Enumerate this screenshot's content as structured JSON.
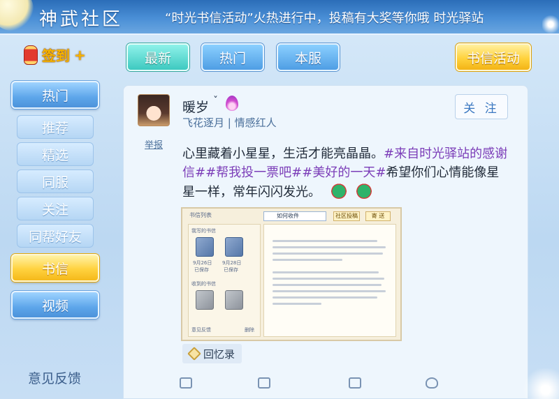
{
  "header": {
    "app_title": "神武社区",
    "marquee": "“时光书信活动”火热进行中，投稿有大奖等你哦     时光驿站"
  },
  "signin": {
    "label": "签到",
    "plus": "+"
  },
  "tabs": [
    {
      "label": "最新",
      "active": true
    },
    {
      "label": "热门",
      "active": false
    },
    {
      "label": "本服",
      "active": false
    },
    {
      "label": "书信活动",
      "active": false
    }
  ],
  "sidebar": {
    "items": [
      {
        "label": "热门",
        "kind": "main",
        "active": false
      },
      {
        "label": "推荐",
        "kind": "sub",
        "active": false
      },
      {
        "label": "精选",
        "kind": "sub",
        "active": false
      },
      {
        "label": "同服",
        "kind": "sub",
        "active": false
      },
      {
        "label": "关注",
        "kind": "sub",
        "active": false
      },
      {
        "label": "同帮好友",
        "kind": "sub",
        "active": false
      },
      {
        "label": "书信",
        "kind": "main",
        "active": true
      },
      {
        "label": "视频",
        "kind": "main",
        "active": false
      }
    ],
    "feedback": "意见反馈"
  },
  "post": {
    "username": "暖岁",
    "gender_mark": "ˇ",
    "tags": "飞花逐月 | 情感红人",
    "follow_label": "关 注",
    "report_label": "举报",
    "text_plain_1": "心里藏着小星星，生活才能亮晶晶。",
    "text_hash_1": "#来自时光驿站的感谢信##帮我投一票吧##美好的一天#",
    "text_plain_2": "希望你们心情能像星星一样，常年闪闪发光。",
    "emoji_icons": [
      "frog-emoji-icon",
      "frog-emoji-icon"
    ],
    "memory_tag": "回忆录",
    "image": {
      "list_title": "书信列表",
      "select_value": "如何收件",
      "btn_submit": "社区投稿",
      "btn_send": "寄 送",
      "my_letters": "我写的书信",
      "letter1_date": "9月26日",
      "letter1_status": "已保存",
      "letter2_date": "9月28日",
      "letter2_status": "已保存",
      "received": "收到的书信",
      "feedback": "意见反馈",
      "delete": "删除"
    }
  },
  "colors": {
    "accent_blue": "#4f9ee4",
    "tab_active_teal": "#3ec9c0",
    "gold": "#ffd23c",
    "hashtag_purple": "#7b3db8"
  }
}
